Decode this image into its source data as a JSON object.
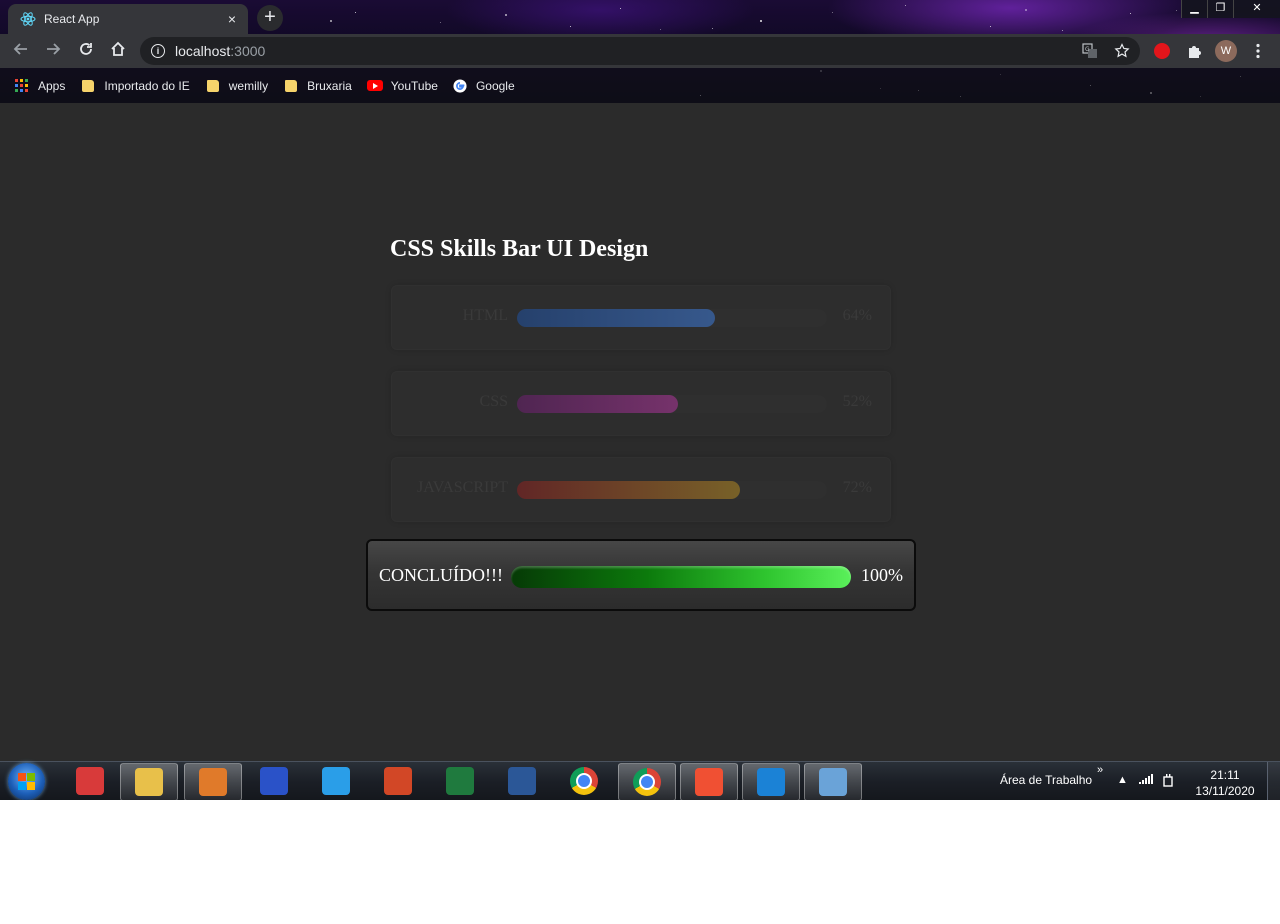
{
  "browser": {
    "tab_title": "React App",
    "tab_close": "×",
    "new_tab": "+",
    "url_host": "localhost",
    "url_port": ":3000",
    "window_minimize": "▁",
    "window_restore": "❐",
    "window_close": "✕",
    "profile_initial": "W"
  },
  "bookmarks": [
    {
      "label": "Apps",
      "icon": "apps-grid-icon"
    },
    {
      "label": "Importado do IE",
      "icon": "folder-icon"
    },
    {
      "label": "wemilly",
      "icon": "folder-icon"
    },
    {
      "label": "Bruxaria",
      "icon": "folder-icon"
    },
    {
      "label": "YouTube",
      "icon": "youtube-icon"
    },
    {
      "label": "Google",
      "icon": "google-icon"
    }
  ],
  "page": {
    "title": "CSS Skills Bar UI Design",
    "skills": [
      {
        "name": "HTML",
        "percent_label": "64%",
        "value": 64,
        "color_from": "#1e4f9e",
        "color_to": "#3d7ad8"
      },
      {
        "name": "CSS",
        "percent_label": "52%",
        "value": 52,
        "color_from": "#6a1d6e",
        "color_to": "#b0359c"
      },
      {
        "name": "JAVASCRIPT",
        "percent_label": "72%",
        "value": 72,
        "color_from": "#8a1f1f",
        "color_to": "#b38a22"
      }
    ],
    "done": {
      "label": "CONCLUÍDO!!!",
      "percent_label": "100%",
      "value": 100
    }
  },
  "taskbar": {
    "apps": [
      {
        "name": "snipping-tool-icon",
        "color": "#d83a3a",
        "active": false
      },
      {
        "name": "file-explorer-icon",
        "color": "#e8c04a",
        "active": true
      },
      {
        "name": "media-player-icon",
        "color": "#e07a2a",
        "active": true
      },
      {
        "name": "scanner-app-icon",
        "color": "#2a52c8",
        "active": false
      },
      {
        "name": "internet-explorer-icon",
        "color": "#2a9ee8",
        "active": false
      },
      {
        "name": "powerpoint-icon",
        "color": "#d24726",
        "active": false
      },
      {
        "name": "excel-icon",
        "color": "#1f7a3e",
        "active": false
      },
      {
        "name": "word-icon",
        "color": "#2b5797",
        "active": false
      },
      {
        "name": "chrome-icon",
        "color": "#f2b400",
        "active": false
      },
      {
        "name": "chrome-profile-icon",
        "color": "#f2b400",
        "active": true
      },
      {
        "name": "git-icon",
        "color": "#f05033",
        "active": true
      },
      {
        "name": "vscode-icon",
        "color": "#1b82d6",
        "active": true
      },
      {
        "name": "paint-icon",
        "color": "#6aa3d8",
        "active": true
      }
    ],
    "desktop_label": "Área de Trabalho",
    "tray_chevron": "»",
    "time": "21:11",
    "date": "13/11/2020"
  }
}
